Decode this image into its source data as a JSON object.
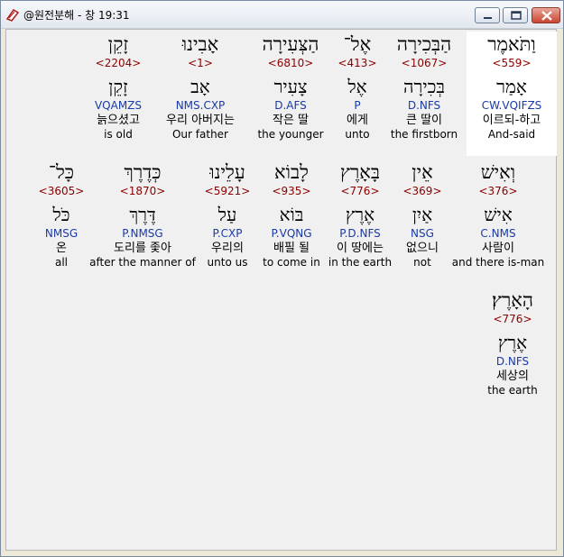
{
  "window": {
    "title": "@원전분해 - 창 19:31"
  },
  "rows": [
    [
      {
        "hebrew": "וַתֹּאמֶר",
        "number": "<559>",
        "lemma": "אָמַר",
        "parsing": "CW.VQIFZS",
        "korean": "이르되-하고",
        "english": "And-said",
        "selected": true
      },
      {
        "hebrew": "הַבְּכִירָה",
        "number": "<1067>",
        "lemma": "בְּכִירָה",
        "parsing": "D.NFS",
        "korean": "큰 딸이",
        "english": "the firstborn"
      },
      {
        "hebrew": "אֶל־",
        "number": "<413>",
        "lemma": "אֶל",
        "parsing": "P",
        "korean": "에게",
        "english": "unto"
      },
      {
        "hebrew": "הַצְּעִירָה",
        "number": "<6810>",
        "lemma": "צָעִיר",
        "parsing": "D.AFS",
        "korean": "작은 딸",
        "english": "the younger"
      },
      {
        "hebrew": "אָבִינוּ",
        "number": "<1>",
        "lemma": "אָב",
        "parsing": "NMS.CXP",
        "korean": "우리 아버지는",
        "english": "Our father"
      },
      {
        "hebrew": "זָקֵן",
        "number": "<2204>",
        "lemma": "זָקֵן",
        "parsing": "VQAMZS",
        "korean": "늙으셨고",
        "english": "is old"
      }
    ],
    [
      {
        "hebrew": "וְאִישׁ",
        "number": "<376>",
        "lemma": "אִישׁ",
        "parsing": "C.NMS",
        "korean": "사람이",
        "english": "and there is-man"
      },
      {
        "hebrew": "אֵין",
        "number": "<369>",
        "lemma": "אַיִן",
        "parsing": "NSG",
        "korean": "없으니",
        "english": "not"
      },
      {
        "hebrew": "בָּאָרֶץ",
        "number": "<776>",
        "lemma": "אֶרֶץ",
        "parsing": "P.D.NFS",
        "korean": "이 땅에는",
        "english": "in the earth"
      },
      {
        "hebrew": "לָבוֹא",
        "number": "<935>",
        "lemma": "בּוֹא",
        "parsing": "P.VQNG",
        "korean": "배필 될",
        "english": "to come in"
      },
      {
        "hebrew": "עָלֵינוּ",
        "number": "<5921>",
        "lemma": "עַל",
        "parsing": "P.CXP",
        "korean": "우리의",
        "english": "unto us"
      },
      {
        "hebrew": "כְּדֶרֶךְ",
        "number": "<1870>",
        "lemma": "דֶּרֶךְ",
        "parsing": "P.NMSG",
        "korean": "도리를 좇아",
        "english": "after the manner of"
      },
      {
        "hebrew": "כָּל־",
        "number": "<3605>",
        "lemma": "כֹּל",
        "parsing": "NMSG",
        "korean": "온",
        "english": "all"
      }
    ],
    [
      {
        "hebrew": "הָאָרֶץ׃",
        "number": "<776>",
        "lemma": "אֶרֶץ",
        "parsing": "D.NFS",
        "korean": "세상의",
        "english": "the earth"
      }
    ]
  ]
}
